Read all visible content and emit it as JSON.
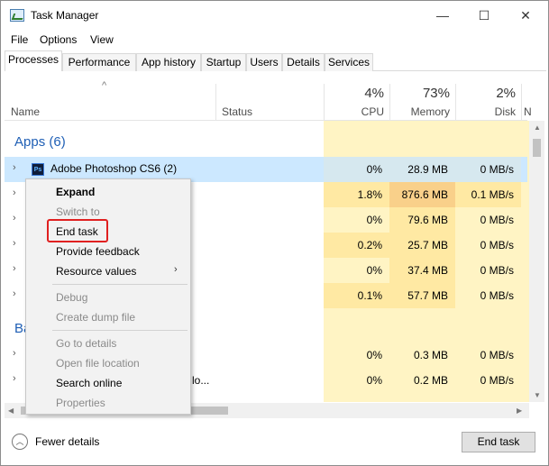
{
  "window": {
    "title": "Task Manager",
    "min_glyph": "—",
    "max_glyph": "☐",
    "close_glyph": "✕",
    "icon": "task-manager-icon"
  },
  "menu": [
    "File",
    "Options",
    "View"
  ],
  "tabs": [
    "Processes",
    "Performance",
    "App history",
    "Startup",
    "Users",
    "Details",
    "Services"
  ],
  "active_tab": "Processes",
  "header": {
    "sort_caret": "^",
    "name": "Name",
    "status": "Status",
    "cpu_pct": "4%",
    "cpu": "CPU",
    "memory_pct": "73%",
    "memory": "Memory",
    "disk_pct": "2%",
    "disk": "Disk",
    "net_partial": "N"
  },
  "groups": {
    "apps": "Apps (6)",
    "background_partial": "Ba"
  },
  "rows": [
    {
      "name": "Adobe Photoshop CS6 (2)",
      "cpu": "0%",
      "memory": "28.9 MB",
      "disk": "0 MB/s"
    },
    {
      "cpu": "1.8%",
      "memory": "876.6 MB",
      "disk": "0.1 MB/s"
    },
    {
      "cpu": "0%",
      "memory": "79.6 MB",
      "disk": "0 MB/s"
    },
    {
      "cpu": "0.2%",
      "memory": "25.7 MB",
      "disk": "0 MB/s"
    },
    {
      "cpu": "0%",
      "memory": "37.4 MB",
      "disk": "0 MB/s"
    },
    {
      "cpu": "0.1%",
      "memory": "57.7 MB",
      "disk": "0 MB/s"
    },
    {
      "cpu": "0%",
      "memory": "0.3 MB",
      "disk": "0 MB/s"
    },
    {
      "name_partial": "lo...",
      "cpu": "0%",
      "memory": "0.2 MB",
      "disk": "0 MB/s"
    }
  ],
  "context_menu": {
    "expand": "Expand",
    "switch_to": "Switch to",
    "end_task": "End task",
    "provide_feedback": "Provide feedback",
    "resource_values": "Resource values",
    "submenu_arrow": "›",
    "debug": "Debug",
    "create_dump": "Create dump file",
    "go_to_details": "Go to details",
    "open_file_location": "Open file location",
    "search_online": "Search online",
    "properties": "Properties"
  },
  "footer": {
    "fewer_details": "Fewer details",
    "end_task_button": "End task"
  },
  "colors": {
    "heat_light": "#fff4c4",
    "heat_medium": "#ffe9a3",
    "heat_high": "#f9d08a",
    "selected_row": "#cce8ff",
    "group_label": "#1f5fb5",
    "highlight_box": "#e02020"
  }
}
